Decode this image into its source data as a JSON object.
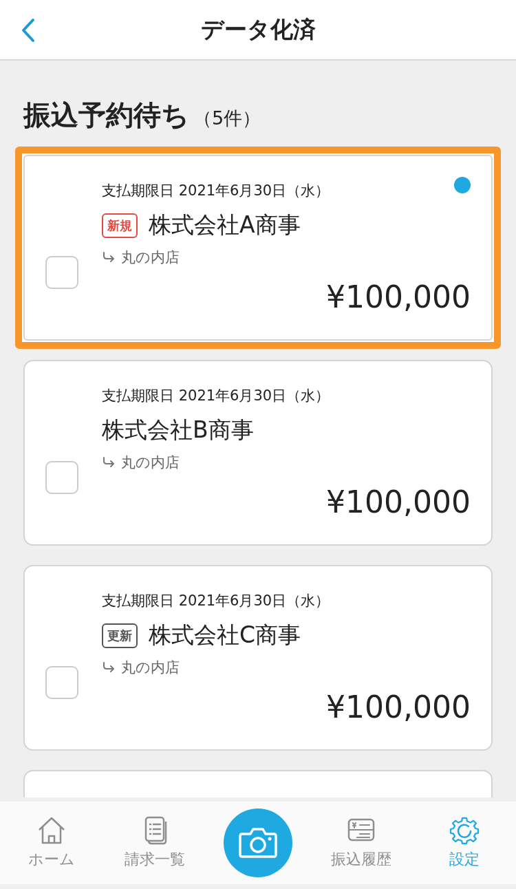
{
  "header": {
    "title": "データ化済"
  },
  "section": {
    "title": "振込予約待ち",
    "count": "（5件）"
  },
  "cards": [
    {
      "kind": "full",
      "highlighted": true,
      "unread": true,
      "due": "支払期限日 2021年6月30日（水）",
      "badge": {
        "kind": "new",
        "label": "新規"
      },
      "company": "株式会社A商事",
      "branch": "丸の内店",
      "amount": "¥100,000",
      "checked": false
    },
    {
      "kind": "full",
      "highlighted": false,
      "unread": false,
      "due": "支払期限日 2021年6月30日（水）",
      "company": "株式会社B商事",
      "branch": "丸の内店",
      "amount": "¥100,000",
      "checked": false
    },
    {
      "kind": "full",
      "highlighted": false,
      "unread": false,
      "due": "支払期限日 2021年6月30日（水）",
      "badge": {
        "kind": "update",
        "label": "更新"
      },
      "company": "株式会社C商事",
      "branch": "丸の内店",
      "amount": "¥100,000",
      "checked": false
    },
    {
      "kind": "covered"
    }
  ],
  "tabs": [
    {
      "kind": "home",
      "label": "ホーム",
      "selected": false
    },
    {
      "kind": "list",
      "label": "請求一覧",
      "selected": false
    },
    {
      "kind": "camera"
    },
    {
      "kind": "history",
      "label": "振込履歴",
      "selected": false
    },
    {
      "kind": "settings",
      "label": "設定",
      "selected": true
    }
  ]
}
